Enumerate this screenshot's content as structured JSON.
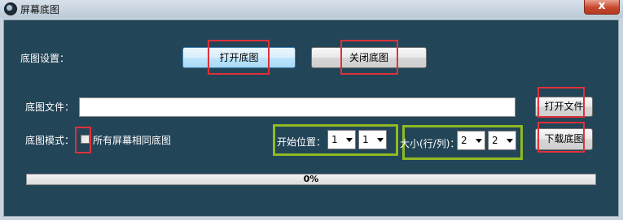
{
  "window": {
    "title": "屏幕底图",
    "close_glyph": "x"
  },
  "basemap_settings": {
    "label": "底图设置：",
    "open_button": "打开底图",
    "close_button": "关闭底图"
  },
  "file": {
    "label": "底图文件：",
    "path_value": "",
    "open_file_button": "打开文件"
  },
  "mode": {
    "label": "底图模式：",
    "same_for_all_label": "所有屏幕相同底图",
    "same_for_all_checked": false
  },
  "start_position": {
    "label": "开始位置：",
    "row_value": "1",
    "col_value": "1"
  },
  "size": {
    "label": "大小(行/列)：",
    "rows_value": "2",
    "cols_value": "2"
  },
  "download_button": "下载底图",
  "progress": {
    "percent": 0,
    "text": "0%"
  },
  "colors": {
    "panel_background": "#234558",
    "highlight_red": "#e0303a",
    "highlight_green": "#8fba23"
  }
}
